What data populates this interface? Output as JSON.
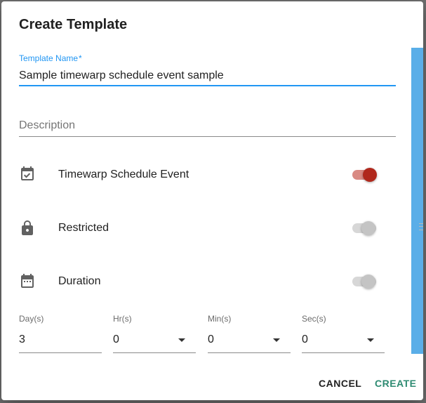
{
  "dialog": {
    "title": "Create Template",
    "template_name": {
      "label": "Template Name",
      "required_marker": "*",
      "value": "Sample timewarp schedule event sample"
    },
    "description": {
      "placeholder": "Description"
    },
    "rows": [
      {
        "label": "Timewarp Schedule Event",
        "icon": "calendar-check-icon",
        "enabled": true
      },
      {
        "label": "Restricted",
        "icon": "lock-icon",
        "enabled": false
      },
      {
        "label": "Duration",
        "icon": "calendar-icon",
        "enabled": false
      }
    ],
    "duration": {
      "days": {
        "label": "Day(s)",
        "value": "3"
      },
      "hours": {
        "label": "Hr(s)",
        "value": "0"
      },
      "minutes": {
        "label": "Min(s)",
        "value": "0"
      },
      "seconds": {
        "label": "Sec(s)",
        "value": "0"
      }
    },
    "actions": {
      "cancel": "CANCEL",
      "create": "CREATE"
    }
  },
  "colors": {
    "accent_blue": "#2196f3",
    "toggle_on": "#b0281c",
    "create_button": "#2e8b72"
  }
}
